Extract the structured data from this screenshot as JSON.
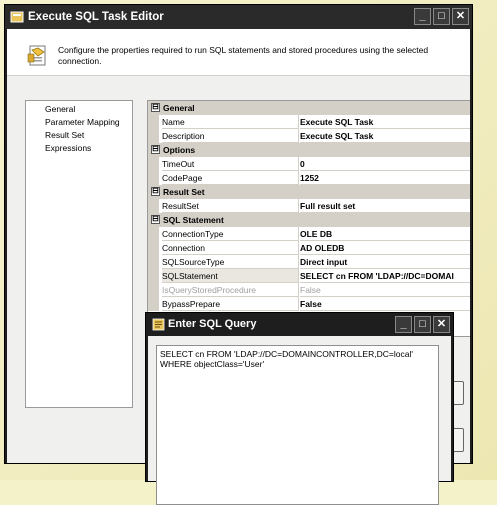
{
  "main_dialog": {
    "title": "Execute SQL Task Editor",
    "description": "Configure the properties required to run SQL statements and stored procedures using the selected connection."
  },
  "nav": {
    "items": [
      "General",
      "Parameter Mapping",
      "Result Set",
      "Expressions"
    ]
  },
  "property_grid": {
    "sections": [
      {
        "name": "General",
        "expander": "⊟"
      },
      {
        "name": "Options",
        "expander": "⊟"
      },
      {
        "name": "Result Set",
        "expander": "⊟"
      },
      {
        "name": "SQL Statement",
        "expander": "⊟"
      }
    ],
    "props": [
      {
        "name": "Name",
        "value": "Execute SQL Task"
      },
      {
        "name": "Description",
        "value": "Execute SQL Task"
      },
      {
        "name": "TimeOut",
        "value": "0"
      },
      {
        "name": "CodePage",
        "value": "1252"
      },
      {
        "name": "ResultSet",
        "value": "Full result set"
      },
      {
        "name": "ConnectionType",
        "value": "OLE DB"
      },
      {
        "name": "Connection",
        "value": "AD OLEDB"
      },
      {
        "name": "SQLSourceType",
        "value": "Direct input"
      },
      {
        "name": "SQLStatement",
        "value": "SELECT cn FROM 'LDAP://DC=DOMAI"
      },
      {
        "name": "IsQueryStoredProcedure",
        "value": "False"
      },
      {
        "name": "BypassPrepare",
        "value": "False"
      }
    ]
  },
  "query_dialog": {
    "title": "Enter SQL Query",
    "query_text": "SELECT cn FROM 'LDAP://DC=DOMAINCONTROLLER,DC=local'\nWHERE objectClass='User'"
  },
  "window_buttons": {
    "minimize": "_",
    "maximize": "□",
    "close": "✕"
  },
  "colors": {
    "title_bar": "#2a2a2a",
    "dialog_body": "#f0f0ee",
    "category_row": "#d4d0c8",
    "page_background": "#f4f2c8"
  }
}
